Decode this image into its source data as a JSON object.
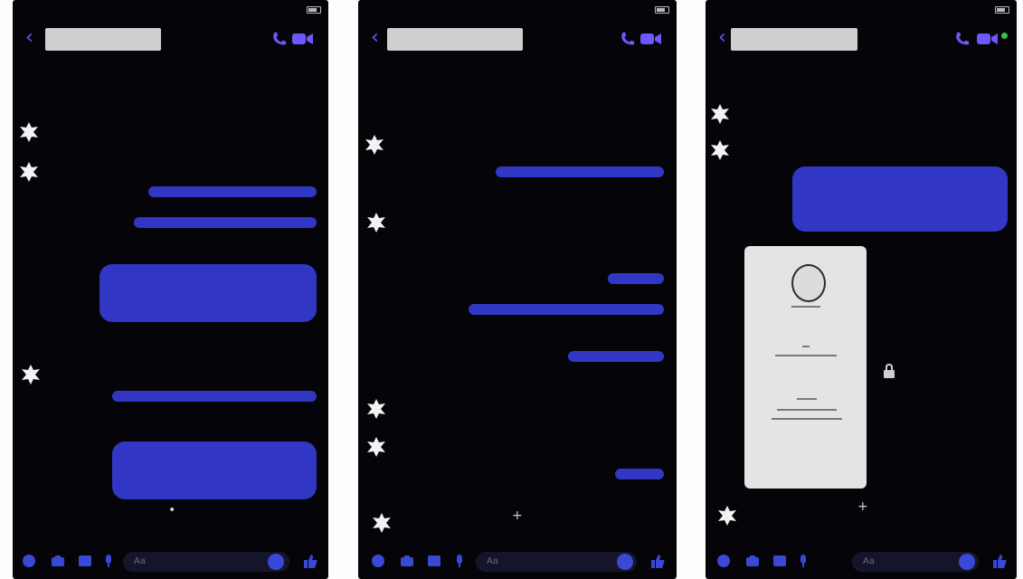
{
  "colors": {
    "accent": "#6d57ff",
    "bubble": "#3136c4",
    "background": "#050509",
    "redacted": "#cfcfcf"
  },
  "composer": {
    "placeholder": "Aa"
  },
  "screens": [
    {
      "status": {
        "carrier": "",
        "time": "",
        "battery": ""
      },
      "timestamp": "",
      "messages": [
        {
          "side": "in",
          "text": ""
        },
        {
          "side": "in",
          "text": ""
        },
        {
          "side": "out",
          "text": ""
        },
        {
          "side": "out",
          "text": ""
        },
        {
          "side": "out",
          "text": ""
        },
        {
          "side": "in",
          "text": ""
        },
        {
          "side": "out",
          "text": ""
        },
        {
          "side": "out",
          "text": ""
        }
      ]
    },
    {
      "status": {
        "carrier": "",
        "time": "",
        "battery": ""
      },
      "timestamp": "",
      "timestamp2": "",
      "messages": [
        {
          "side": "in",
          "text": ""
        },
        {
          "side": "in",
          "text": ""
        },
        {
          "side": "out",
          "text": ""
        },
        {
          "side": "in",
          "text": ""
        },
        {
          "side": "out",
          "text": ""
        },
        {
          "side": "out",
          "text": ""
        },
        {
          "side": "out",
          "text": ""
        },
        {
          "side": "in",
          "text": ""
        },
        {
          "side": "in",
          "text": ""
        },
        {
          "side": "out",
          "text": ""
        },
        {
          "side": "in",
          "text": ""
        }
      ]
    },
    {
      "status": {
        "carrier": "",
        "time": "",
        "battery": ""
      },
      "timestamp": "",
      "messages": [
        {
          "side": "in",
          "text": ""
        },
        {
          "side": "in",
          "text": ""
        },
        {
          "side": "out",
          "text": ""
        },
        {
          "side": "in",
          "text": ""
        }
      ]
    }
  ]
}
